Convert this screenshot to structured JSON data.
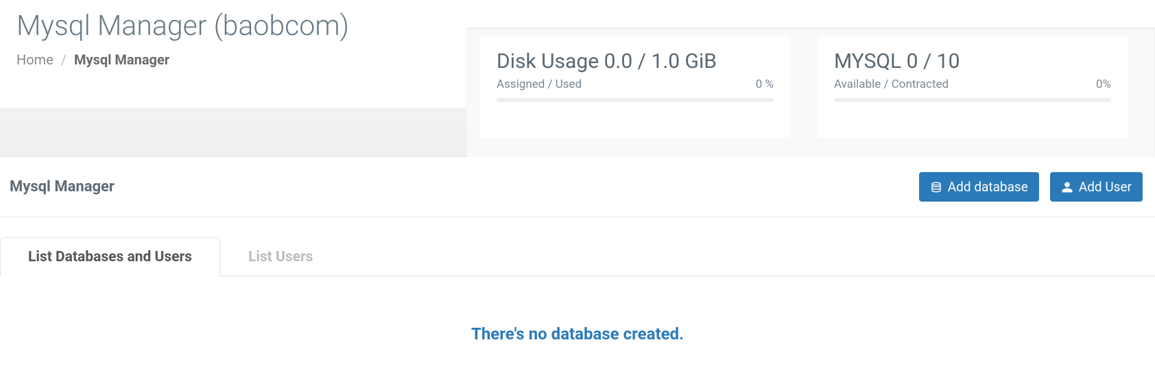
{
  "header": {
    "title": "Mysql Manager (baobcom)",
    "breadcrumb": {
      "home": "Home",
      "current": "Mysql Manager"
    }
  },
  "stats": {
    "disk": {
      "title": "Disk Usage 0.0 / 1.0 GiB",
      "subLabel": "Assigned / Used",
      "percent": "0 %"
    },
    "mysql": {
      "title": "MYSQL 0 / 10",
      "subLabel": "Available / Contracted",
      "percent": "0%"
    }
  },
  "panel": {
    "title": "Mysql Manager",
    "actions": {
      "addDatabase": "Add database",
      "addUser": "Add User"
    }
  },
  "tabs": {
    "listDbUsers": "List Databases and Users",
    "listUsers": "List Users"
  },
  "emptyMessage": "There's no database created."
}
